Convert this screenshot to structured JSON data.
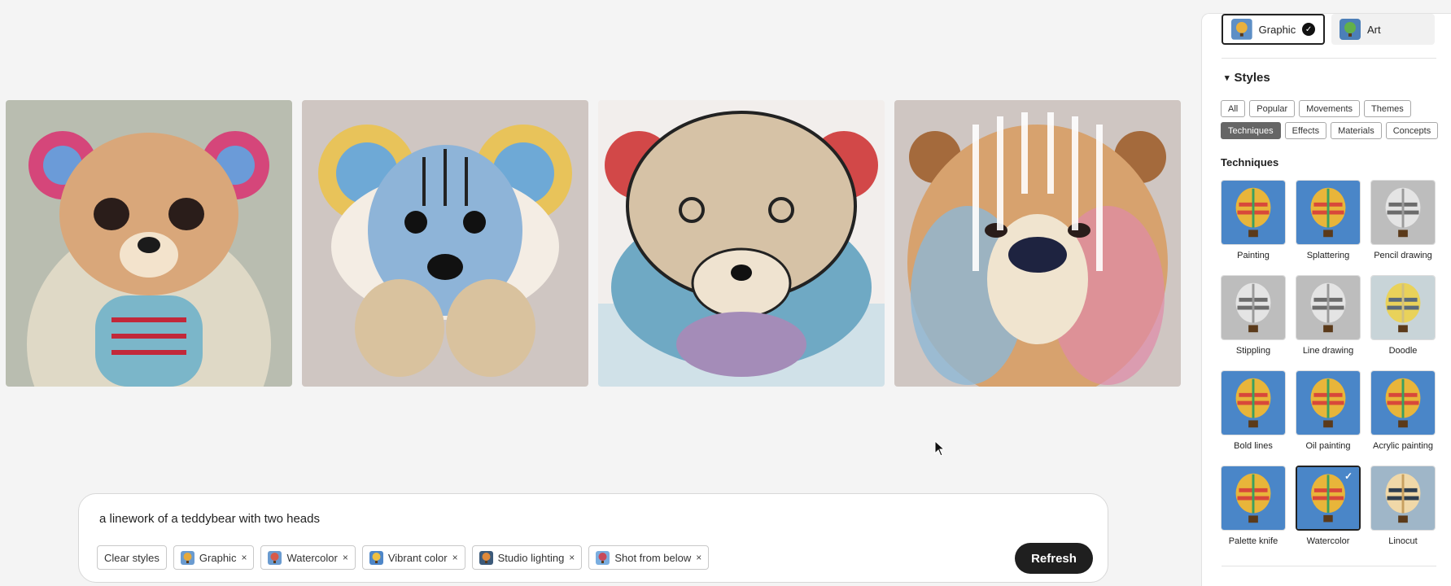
{
  "images": [
    {
      "name": "bear-image-1",
      "bg": "#b9bdb0"
    },
    {
      "name": "bear-image-2",
      "bg": "#cfc6c2"
    },
    {
      "name": "bear-image-3",
      "bg": "#f2eeec"
    },
    {
      "name": "bear-image-4",
      "bg": "#cfc6c2"
    }
  ],
  "prompt": {
    "text": "a linework of a teddybear with two heads",
    "clear_label": "Clear styles",
    "chips": [
      {
        "label": "Graphic",
        "remove": "×"
      },
      {
        "label": "Watercolor",
        "remove": "×"
      },
      {
        "label": "Vibrant color",
        "remove": "×"
      },
      {
        "label": "Studio lighting",
        "remove": "×"
      },
      {
        "label": "Shot from below",
        "remove": "×"
      }
    ],
    "refresh_label": "Refresh"
  },
  "panel": {
    "content_types": [
      {
        "label": "Graphic",
        "selected": true
      },
      {
        "label": "Art",
        "selected": false
      }
    ],
    "styles_title": "Styles",
    "filters": [
      {
        "label": "All",
        "active": false
      },
      {
        "label": "Popular",
        "active": false
      },
      {
        "label": "Movements",
        "active": false
      },
      {
        "label": "Themes",
        "active": false
      },
      {
        "label": "Techniques",
        "active": true
      },
      {
        "label": "Effects",
        "active": false
      },
      {
        "label": "Materials",
        "active": false
      },
      {
        "label": "Concepts",
        "active": false
      }
    ],
    "techniques_title": "Techniques",
    "techniques": [
      {
        "label": "Painting",
        "style": "color",
        "selected": false
      },
      {
        "label": "Splattering",
        "style": "color",
        "selected": false
      },
      {
        "label": "Pencil drawing",
        "style": "gray",
        "selected": false
      },
      {
        "label": "Stippling",
        "style": "gray",
        "selected": false
      },
      {
        "label": "Line drawing",
        "style": "gray",
        "selected": false
      },
      {
        "label": "Doodle",
        "style": "yellow",
        "selected": false
      },
      {
        "label": "Bold lines",
        "style": "color",
        "selected": false
      },
      {
        "label": "Oil painting",
        "style": "color",
        "selected": false
      },
      {
        "label": "Acrylic painting",
        "style": "color",
        "selected": false
      },
      {
        "label": "Palette knife",
        "style": "color",
        "selected": false
      },
      {
        "label": "Watercolor",
        "style": "color",
        "selected": true
      },
      {
        "label": "Linocut",
        "style": "dark",
        "selected": false
      }
    ]
  }
}
